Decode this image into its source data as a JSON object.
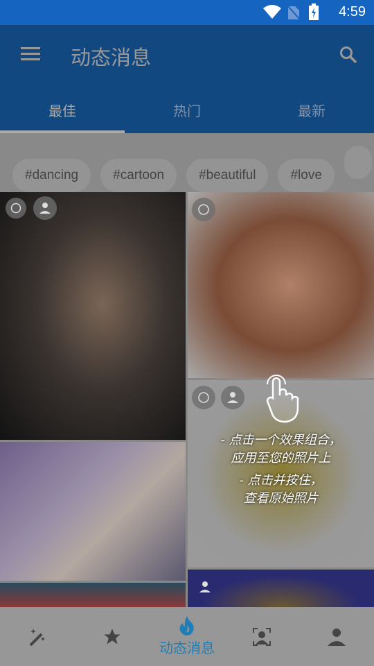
{
  "status_bar": {
    "time": "4:59"
  },
  "app_bar": {
    "title": "动态消息"
  },
  "tabs": [
    {
      "label": "最佳",
      "active": true
    },
    {
      "label": "热门"
    },
    {
      "label": "最新"
    }
  ],
  "hashtags": [
    "#dancing",
    "#cartoon",
    "#beautiful",
    "#love"
  ],
  "overlay": {
    "lines": [
      "- 点击一个效果组合，",
      "应用至您的照片上",
      "- 点击并按住，",
      "查看原始照片"
    ]
  },
  "bottom_nav": {
    "active_label": "动态消息",
    "items": [
      "magic-wand",
      "favorites",
      "feed",
      "face-scan",
      "profile"
    ]
  },
  "colors": {
    "status": "#1565c0",
    "appbar": "#114880",
    "accent": "#1e7fb8"
  }
}
